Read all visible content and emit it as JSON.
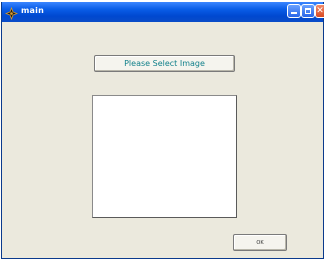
{
  "window": {
    "title": "main",
    "icon": "matlab-figure-icon",
    "title_bar_color": "#0a5ee8",
    "background_color": "#ebe9dd"
  },
  "title_bar_buttons": {
    "minimize_icon": "minimize-icon",
    "maximize_icon": "maximize-icon",
    "close_icon": "close-icon",
    "close_glyph": "✕"
  },
  "main": {
    "select_button_label": "Please Select Image",
    "select_button_text_color": "#0f7f8a",
    "ok_button_label": "OK"
  }
}
